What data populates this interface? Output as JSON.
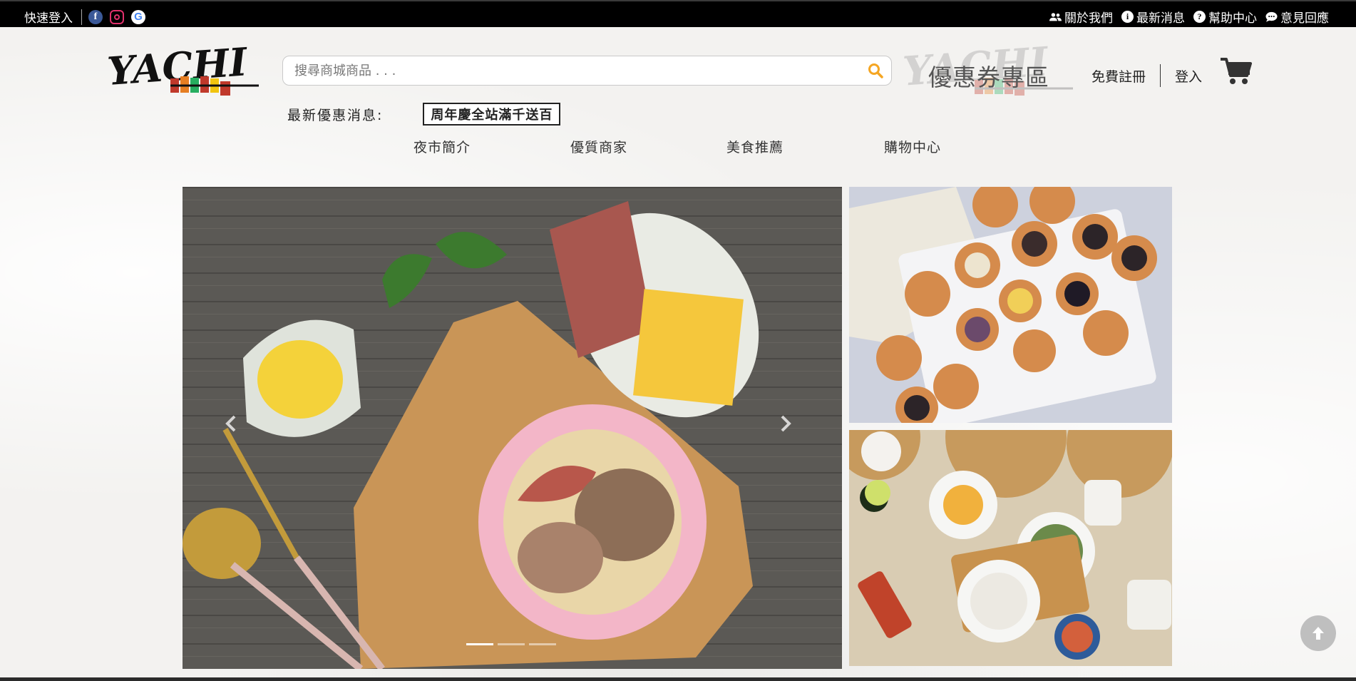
{
  "topbar": {
    "quick_login": "快速登入",
    "social": [
      "facebook-icon",
      "instagram-icon",
      "google-icon"
    ],
    "links": [
      {
        "icon": "users-icon",
        "label": "關於我們"
      },
      {
        "icon": "info-icon",
        "label": "最新消息"
      },
      {
        "icon": "help-icon",
        "label": "幫助中心"
      },
      {
        "icon": "chat-icon",
        "label": "意見回應"
      }
    ]
  },
  "header": {
    "logo_text": "YACHI",
    "search_placeholder": "搜尋商城商品 . . .",
    "coupon_zone": "優惠券專區",
    "register": "免費註冊",
    "login": "登入"
  },
  "promo": {
    "label": "最新優惠消息:",
    "message": "周年慶全站滿千送百"
  },
  "nav": [
    {
      "label": "夜市簡介"
    },
    {
      "label": "優質商家"
    },
    {
      "label": "美食推薦"
    },
    {
      "label": "購物中心"
    }
  ],
  "carousel": {
    "slide_count": 3,
    "active_index": 0
  },
  "colors": {
    "topbar": "#000000",
    "search_icon": "#f5a623",
    "cart": "#333333"
  }
}
